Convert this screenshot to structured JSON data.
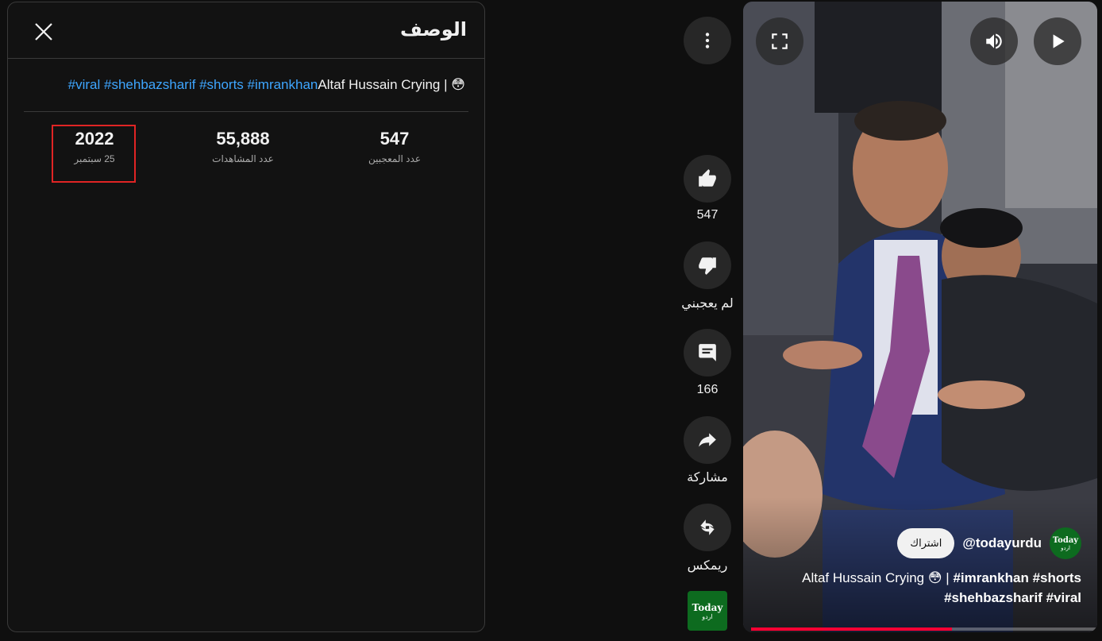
{
  "description_panel": {
    "title": "الوصف",
    "text_prefix": "| 😳",
    "text_title": "Altaf Hussain Crying",
    "hashtags": [
      "#imrankhan",
      "#shorts",
      "#shehbazsharif",
      "#viral"
    ],
    "stats": {
      "likes_value": "547",
      "likes_label": "عدد المعجبين",
      "views_value": "55,888",
      "views_label": "عدد المشاهدات",
      "date_year": "2022",
      "date_day": "25 سبتمبر"
    }
  },
  "actions": {
    "like_count": "547",
    "dislike_label": "لم يعجبني",
    "comment_count": "166",
    "share_label": "مشاركة",
    "remix_label": "ريمكس",
    "channel_thumb_line1": "Today",
    "channel_thumb_line2": "اردو"
  },
  "video": {
    "channel_handle": "@todayurdu",
    "subscribe_label": "اشتراك",
    "avatar_line1": "Today",
    "avatar_line2": "اردو",
    "title_line1_plain": "Altaf Hussain Crying 😳 | ",
    "title_line1_bold": "#imrankhan #shorts",
    "title_line2_bold": "#shehbazsharif #viral",
    "progress_fraction": 0.58
  }
}
